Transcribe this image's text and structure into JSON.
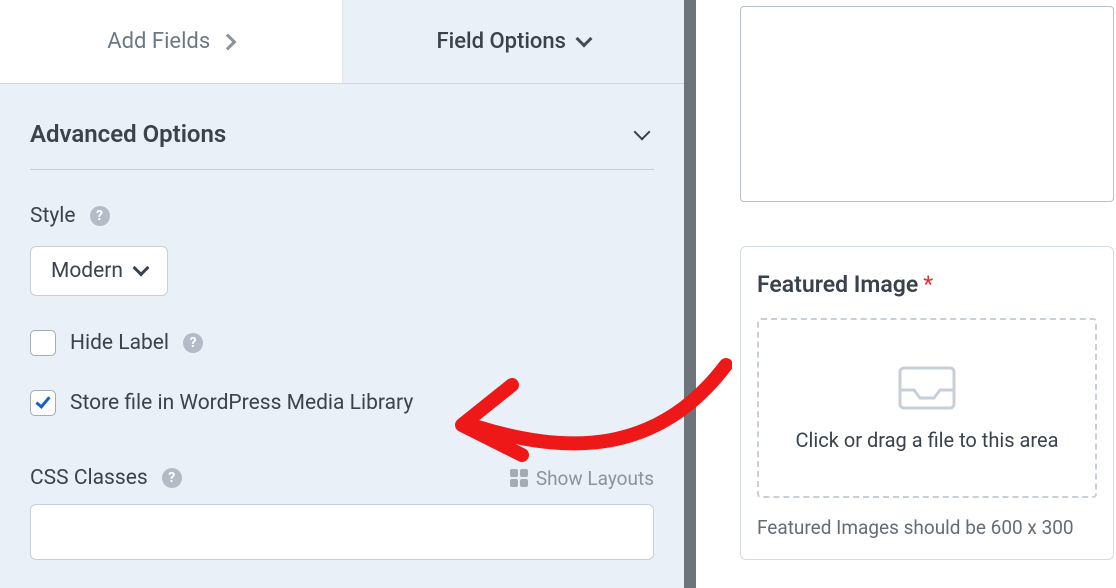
{
  "tabs": {
    "add_fields": "Add Fields",
    "field_options": "Field Options"
  },
  "advanced": {
    "title": "Advanced Options"
  },
  "style": {
    "label": "Style",
    "selected": "Modern"
  },
  "hide_label": {
    "label": "Hide Label",
    "checked": false
  },
  "store_media": {
    "label": "Store file in WordPress Media Library",
    "checked": true
  },
  "css_classes": {
    "label": "CSS Classes",
    "show_layouts": "Show Layouts",
    "value": ""
  },
  "featured": {
    "title": "Featured Image",
    "required": "*",
    "drop_text": "Click or drag a file to this area",
    "hint": "Featured Images should be 600 x 300"
  }
}
